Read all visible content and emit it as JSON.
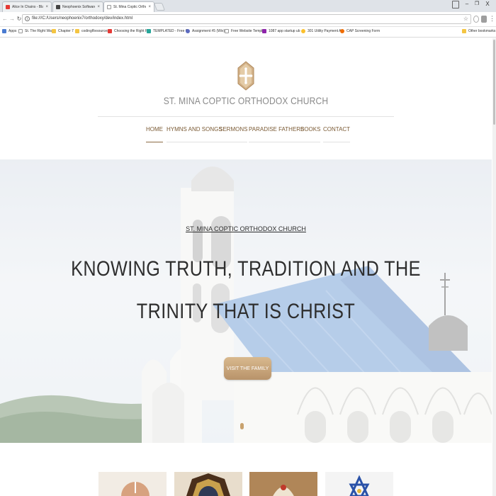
{
  "browser": {
    "tabs": [
      {
        "label": "Alice In Chains - Blac",
        "favicon_color": "#e53935"
      },
      {
        "label": "Neophoenix Software",
        "favicon_color": "#444444"
      },
      {
        "label": "St. Mina Coptic Orthoc",
        "favicon_color": "#9e9e9e"
      }
    ],
    "close_glyph": "×",
    "window_controls": {
      "minimize": "–",
      "restore": "❐",
      "close": "X"
    },
    "url": "file:///C:/Users/neophoenix7/orthodoxy/dev/index.html",
    "bookmarks": [
      {
        "label": "Apps",
        "icon_color": "#4a7bd1"
      },
      {
        "label": "St. The Right Way",
        "icon_color": "#9e9e9e"
      },
      {
        "label": "Chapter 7",
        "icon_color": "#f4c542"
      },
      {
        "label": "codingResources",
        "icon_color": "#f4c542"
      },
      {
        "label": "Choosing the Right P",
        "icon_color": "#e53935"
      },
      {
        "label": "TEMPLATED - Free C",
        "icon_color": "#26a69a"
      },
      {
        "label": "Assignment #5 (Wix)",
        "icon_color": "#5c6bc0"
      },
      {
        "label": "Free Website Templa",
        "icon_color": "#9e9e9e"
      },
      {
        "label": "1087 app startup ub",
        "icon_color": "#8e24aa"
      },
      {
        "label": "301 Utility Payment A",
        "icon_color": "#fbc02d"
      },
      {
        "label": "CAP Screening Form",
        "icon_color": "#ef6c00"
      },
      {
        "label": "Other bookmarks",
        "icon_color": "#f4c542"
      }
    ]
  },
  "site": {
    "title": "ST. MINA COPTIC ORTHODOX CHURCH",
    "nav": [
      "HOME",
      "HYMNS AND SONGS",
      "SERMONS",
      "PARADISE FATHERS",
      "BOOKS",
      "CONTACT"
    ],
    "nav_active_index": 0
  },
  "hero": {
    "subtitle": "ST. MINA COPTIC ORTHODOX CHURCH",
    "headline_line1": "KNOWING TRUTH, TRADITION AND THE",
    "headline_line2": "TRINITY THAT IS CHRIST",
    "cta_label": "VISIT THE FAMILY"
  },
  "colors": {
    "accent_gold": "#c8a26e",
    "nav_text": "#7a5a34",
    "title_gray": "#8a8a8a",
    "roof_blue": "#8aaedc"
  },
  "icons": {
    "cross_logo": "coptic-cross-icon"
  }
}
